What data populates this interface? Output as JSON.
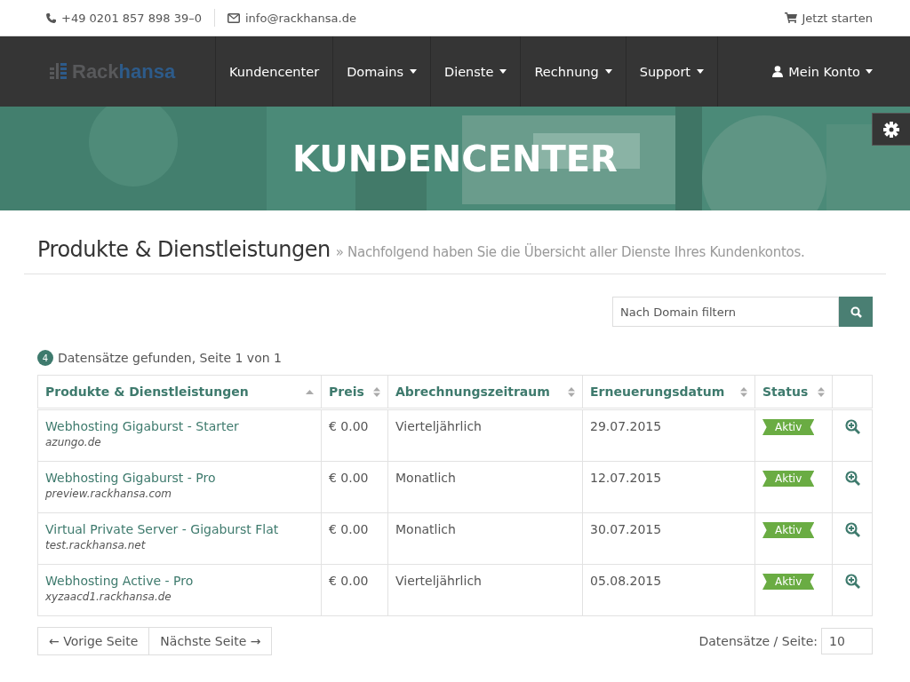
{
  "topbar": {
    "phone": "+49 0201 857 898 39–0",
    "email": "info@rackhansa.de",
    "cart": "Jetzt starten"
  },
  "navbar": {
    "logo": {
      "part_1": "Rack",
      "part_2": "hansa"
    },
    "items": [
      {
        "label": "Kundencenter",
        "dropdown": false
      },
      {
        "label": "Domains",
        "dropdown": true
      },
      {
        "label": "Dienste",
        "dropdown": true
      },
      {
        "label": "Rechnung",
        "dropdown": true
      },
      {
        "label": "Support",
        "dropdown": true
      }
    ],
    "account": {
      "label": "Mein Konto",
      "dropdown": true
    }
  },
  "hero": {
    "title": "KUNDENCENTER"
  },
  "page": {
    "heading": "Produkte & Dienstleistungen",
    "subheading": "» Nachfolgend haben Sie die Übersicht aller Dienste Ihres Kundenkontos."
  },
  "filter": {
    "placeholder": "Nach Domain filtern"
  },
  "summary": {
    "count": "4",
    "text": "Datensätze gefunden, Seite 1 von 1"
  },
  "table": {
    "columns": [
      {
        "label": "Produkte & Dienstleistungen",
        "sorted": true
      },
      {
        "label": "Preis",
        "sorted": false
      },
      {
        "label": "Abrechnungszeitraum",
        "sorted": false
      },
      {
        "label": "Erneuerungsdatum",
        "sorted": false
      },
      {
        "label": "Status",
        "sorted": false
      }
    ],
    "rows": [
      {
        "product": "Webhosting Gigaburst - Starter",
        "domain": "azungo.de",
        "price": "€ 0.00",
        "cycle": "Vierteljährlich",
        "due": "29.07.2015",
        "status": "Aktiv",
        "color": "#6aac43"
      },
      {
        "product": "Webhosting Gigaburst - Pro",
        "domain": "preview.rackhansa.com",
        "price": "€ 0.00",
        "cycle": "Monatlich",
        "due": "12.07.2015",
        "status": "Aktiv",
        "color": "#6aac43"
      },
      {
        "product": "Virtual Private Server - Gigaburst Flat",
        "domain": "test.rackhansa.net",
        "price": "€ 0.00",
        "cycle": "Monatlich",
        "due": "30.07.2015",
        "status": "Aktiv",
        "color": "#6aac43"
      },
      {
        "product": "Webhosting Active - Pro",
        "domain": "xyzaacd1.rackhansa.de",
        "price": "€ 0.00",
        "cycle": "Vierteljährlich",
        "due": "05.08.2015",
        "status": "Aktiv",
        "color": "#6aac43"
      }
    ]
  },
  "pager": {
    "previous": "← Vorige Seite",
    "next": "Nächste Seite →",
    "per_page_label": "Datensätze / Seite:",
    "per_page": "10"
  }
}
